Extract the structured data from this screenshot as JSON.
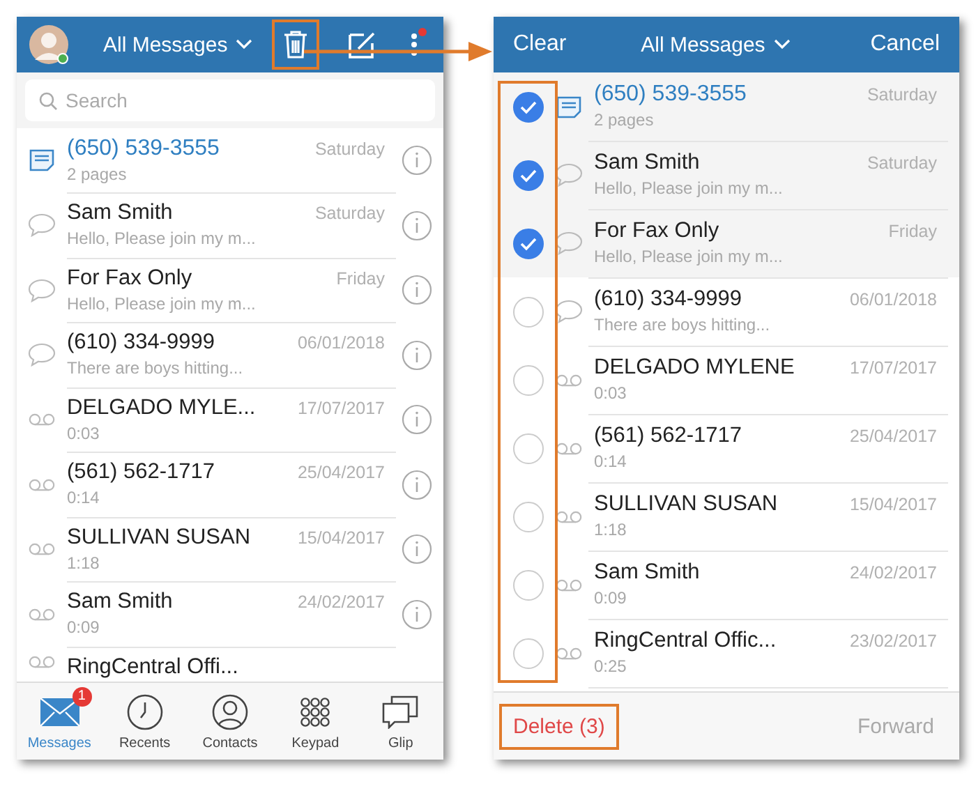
{
  "left_screen": {
    "header": {
      "title": "All Messages",
      "trash_highlighted": true,
      "more_notification": true
    },
    "search": {
      "placeholder": "Search"
    },
    "messages": [
      {
        "kind": "fax",
        "title": "(650) 539-3555",
        "subtitle": "2 pages",
        "date": "Saturday",
        "unread": true
      },
      {
        "kind": "text",
        "title": "Sam Smith",
        "subtitle": "Hello, Please join my m...",
        "date": "Saturday",
        "unread": false
      },
      {
        "kind": "text",
        "title": "For Fax Only",
        "subtitle": "Hello, Please join my m...",
        "date": "Friday",
        "unread": false
      },
      {
        "kind": "text",
        "title": "(610) 334-9999",
        "subtitle": "There are boys hitting...",
        "date": "06/01/2018",
        "unread": false
      },
      {
        "kind": "voicemail",
        "title": "DELGADO MYLE...",
        "subtitle": "0:03",
        "date": "17/07/2017",
        "unread": false
      },
      {
        "kind": "voicemail",
        "title": "(561) 562-1717",
        "subtitle": "0:14",
        "date": "25/04/2017",
        "unread": false
      },
      {
        "kind": "voicemail",
        "title": "SULLIVAN SUSAN",
        "subtitle": "1:18",
        "date": "15/04/2017",
        "unread": false
      },
      {
        "kind": "voicemail",
        "title": "Sam Smith",
        "subtitle": "0:09",
        "date": "24/02/2017",
        "unread": false
      },
      {
        "kind": "voicemail",
        "title": "RingCentral Offi...",
        "unread": false
      }
    ],
    "tabs": [
      {
        "kind": "messages",
        "label": "Messages",
        "selected": true,
        "badge": "1"
      },
      {
        "kind": "recents",
        "label": "Recents",
        "selected": false
      },
      {
        "kind": "contacts",
        "label": "Contacts",
        "selected": false
      },
      {
        "kind": "keypad",
        "label": "Keypad",
        "selected": false
      },
      {
        "kind": "glip",
        "label": "Glip",
        "selected": false
      }
    ]
  },
  "right_screen": {
    "header": {
      "clear": "Clear",
      "title": "All Messages",
      "cancel": "Cancel"
    },
    "messages": [
      {
        "kind": "fax",
        "title": "(650) 539-3555",
        "subtitle": "2 pages",
        "date": "Saturday",
        "unread": true,
        "checked": true
      },
      {
        "kind": "text",
        "title": "Sam Smith",
        "subtitle": "Hello, Please join my m...",
        "date": "Saturday",
        "unread": false,
        "checked": true
      },
      {
        "kind": "text",
        "title": "For Fax Only",
        "subtitle": "Hello, Please join my m...",
        "date": "Friday",
        "unread": false,
        "checked": true
      },
      {
        "kind": "text",
        "title": "(610) 334-9999",
        "subtitle": "There are boys hitting...",
        "date": "06/01/2018",
        "unread": false,
        "checked": false
      },
      {
        "kind": "voicemail",
        "title": "DELGADO MYLENE",
        "subtitle": "0:03",
        "date": "17/07/2017",
        "unread": false,
        "checked": false
      },
      {
        "kind": "voicemail",
        "title": "(561) 562-1717",
        "subtitle": "0:14",
        "date": "25/04/2017",
        "unread": false,
        "checked": false
      },
      {
        "kind": "voicemail",
        "title": "SULLIVAN SUSAN",
        "subtitle": "1:18",
        "date": "15/04/2017",
        "unread": false,
        "checked": false
      },
      {
        "kind": "voicemail",
        "title": "Sam Smith",
        "subtitle": "0:09",
        "date": "24/02/2017",
        "unread": false,
        "checked": false
      },
      {
        "kind": "voicemail",
        "title": "RingCentral Offic...",
        "subtitle": "0:25",
        "date": "23/02/2017",
        "unread": false,
        "checked": false
      }
    ],
    "footer": {
      "delete": "Delete (3)",
      "delete_highlighted": true,
      "forward": "Forward",
      "forward_disabled": true
    },
    "checkbox_column_highlighted": true
  }
}
